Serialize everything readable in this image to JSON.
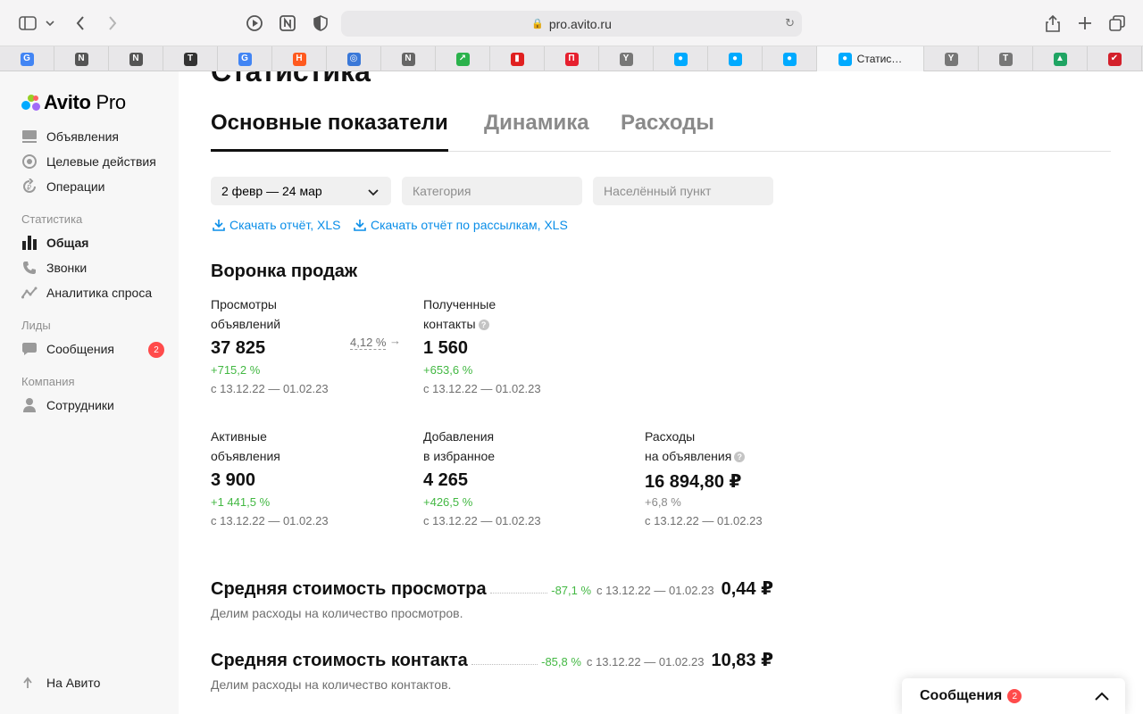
{
  "browser": {
    "url": "pro.avito.ru",
    "active_tab_title": "Статис…",
    "tabs": [
      {
        "icon": "google-icon",
        "glyph": "G",
        "color": "#4285f4"
      },
      {
        "icon": "notion-like-icon",
        "glyph": "N",
        "color": "#555555"
      },
      {
        "icon": "notion-like-icon",
        "glyph": "N",
        "color": "#555555"
      },
      {
        "icon": "t-circle-icon",
        "glyph": "T",
        "color": "#333333"
      },
      {
        "icon": "google-icon",
        "glyph": "G",
        "color": "#4285f4"
      },
      {
        "icon": "orange-app-icon",
        "glyph": "H",
        "color": "#ff5a1f"
      },
      {
        "icon": "planet-icon",
        "glyph": "◎",
        "color": "#3a78d8"
      },
      {
        "icon": "n-square-icon",
        "glyph": "N",
        "color": "#666666"
      },
      {
        "icon": "trend-icon",
        "glyph": "↗",
        "color": "#2bb24c"
      },
      {
        "icon": "bar-chart-icon",
        "glyph": "▮",
        "color": "#e02020"
      },
      {
        "icon": "p-red-icon",
        "glyph": "П",
        "color": "#e6202f"
      },
      {
        "icon": "y-gray-icon",
        "glyph": "Y",
        "color": "#777777"
      },
      {
        "icon": "avito-icon",
        "glyph": "●",
        "color": "#00aaff"
      },
      {
        "icon": "avito-icon",
        "glyph": "●",
        "color": "#00aaff"
      },
      {
        "icon": "avito-icon",
        "glyph": "●",
        "color": "#00aaff"
      }
    ],
    "tabs_after": [
      {
        "icon": "y-gray-icon",
        "glyph": "Y",
        "color": "#777777"
      },
      {
        "icon": "t-gray-icon",
        "glyph": "T",
        "color": "#777777"
      },
      {
        "icon": "drive-icon",
        "glyph": "▲",
        "color": "#1fa463"
      },
      {
        "icon": "checkmark-icon",
        "glyph": "✔",
        "color": "#d3202b"
      }
    ]
  },
  "sidebar": {
    "logo_bold": "Avito",
    "logo_light": " Pro",
    "items": [
      {
        "label": "Объявления",
        "icon": "listings-icon"
      },
      {
        "label": "Целевые действия",
        "icon": "target-icon"
      },
      {
        "label": "Операции",
        "icon": "operations-icon"
      }
    ],
    "section_stats": "Статистика",
    "stats_items": [
      {
        "label": "Общая",
        "icon": "bar-chart-icon",
        "active": true
      },
      {
        "label": "Звонки",
        "icon": "phone-icon"
      },
      {
        "label": "Аналитика спроса",
        "icon": "demand-icon"
      }
    ],
    "section_leads": "Лиды",
    "leads_items": [
      {
        "label": "Сообщения",
        "icon": "chat-icon",
        "badge": "2"
      }
    ],
    "section_company": "Компания",
    "company_items": [
      {
        "label": "Сотрудники",
        "icon": "user-icon"
      }
    ],
    "back_link": "На Авито"
  },
  "main": {
    "title": "Статистика",
    "tabs": [
      "Основные показатели",
      "Динамика",
      "Расходы"
    ],
    "filters": {
      "date": "2 февр — 24 мар",
      "category_placeholder": "Категория",
      "city_placeholder": "Населённый пункт"
    },
    "downloads": [
      "Скачать отчёт, XLS",
      "Скачать отчёт по рассылкам, XLS"
    ],
    "funnel_title": "Воронка продаж",
    "conversion": "4,12 %",
    "metrics": [
      {
        "label1": "Просмотры",
        "label2": "объявлений",
        "value": "37 825",
        "delta": "+715,2 %",
        "period": "с 13.12.22 — 01.02.23",
        "help": false
      },
      {
        "label1": "Полученные",
        "label2": "контакты",
        "value": "1 560",
        "delta": "+653,6 %",
        "period": "с 13.12.22 — 01.02.23",
        "help": true
      },
      {
        "label1": "Активные",
        "label2": "объявления",
        "value": "3 900",
        "delta": "+1 441,5 %",
        "period": "с 13.12.22 — 01.02.23",
        "help": false
      },
      {
        "label1": "Добавления",
        "label2": "в избранное",
        "value": "4 265",
        "delta": "+426,5 %",
        "period": "с 13.12.22 — 01.02.23",
        "help": false
      },
      {
        "label1": "Расходы",
        "label2": "на объявления",
        "value": "16 894,80 ₽",
        "delta": "+6,8 %",
        "period": "с 13.12.22 — 01.02.23",
        "help": true
      }
    ],
    "costs": [
      {
        "title": "Средняя стоимость просмотра",
        "delta": "-87,1 %",
        "period": "с 13.12.22 — 01.02.23",
        "value": "0,44 ₽",
        "note": "Делим расходы на количество просмотров."
      },
      {
        "title": "Средняя стоимость контакта",
        "delta": "-85,8 %",
        "period": "с 13.12.22 — 01.02.23",
        "value": "10,83 ₽",
        "note": "Делим расходы на количество контактов."
      }
    ]
  },
  "messages_widget": {
    "title": "Сообщения",
    "badge": "2"
  },
  "colors": {
    "accent_link": "#0a8ee8",
    "positive": "#43b843",
    "badge": "#ff4b4b"
  }
}
